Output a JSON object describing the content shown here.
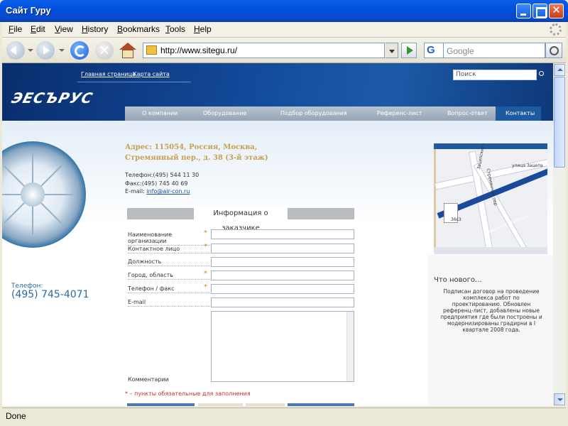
{
  "window": {
    "title": "Сайт Гуру"
  },
  "menu": [
    "File",
    "Edit",
    "View",
    "History",
    "Bookmarks",
    "Tools",
    "Help"
  ],
  "nav": {
    "url": "http://www.sitegu.ru/",
    "search_placeholder": "Google",
    "engine_letter": "G"
  },
  "status": {
    "text": "Done"
  },
  "page": {
    "top_links": [
      "Главная страница",
      "Карта сайта"
    ],
    "search_placeholder": "Поиск",
    "logo_text": "ЭЕСЪРУС",
    "tabs": [
      "О компании",
      "Оборудование",
      "Подбор оборудования",
      "Референс-лист",
      "Вопрос-ответ",
      "Контакты"
    ],
    "active_tab": "Контакты",
    "address_line1": "Адрес: 115054, Россия, Москва,",
    "address_line2": "Стремянный пер., д. 38 (3-й этаж)",
    "phone_line": "Телефон:(495) 544 11 30",
    "fax_line": "Факс:(495) 745 40 69",
    "email_label": "E-mail:",
    "email": "info@air-con.ru",
    "left_phone_label": "Телефон:",
    "left_phone": "(495) 745-4071",
    "form": {
      "title": "Информация о заказчике",
      "fields": [
        {
          "label": "Наименование организации",
          "required": true,
          "value": ""
        },
        {
          "label": "Контактное лицо",
          "required": true,
          "value": ""
        },
        {
          "label": "Должность",
          "required": false,
          "value": ""
        },
        {
          "label": "Город, область",
          "required": true,
          "value": ""
        },
        {
          "label": "Телефон / факс",
          "required": true,
          "value": ""
        },
        {
          "label": "E-mail",
          "required": false,
          "value": ""
        }
      ],
      "comment_label": "Комментарии",
      "required_mark": "*",
      "required_note": "* – пункты обязательные для заполнения"
    },
    "map": {
      "streets": [
        "улица Зацепа",
        "Стремянный переулок",
        "Стремянный пер",
        "Зацепский вал"
      ],
      "building": "36с3"
    },
    "news": {
      "title": "Что нового...",
      "body": "Подписан договор на проведение комплекса работ по проектированию. Обновлен референц-лист, добавлены новые предприятия где были построены и модернизированы градирни в I квартале 2008 года."
    }
  }
}
